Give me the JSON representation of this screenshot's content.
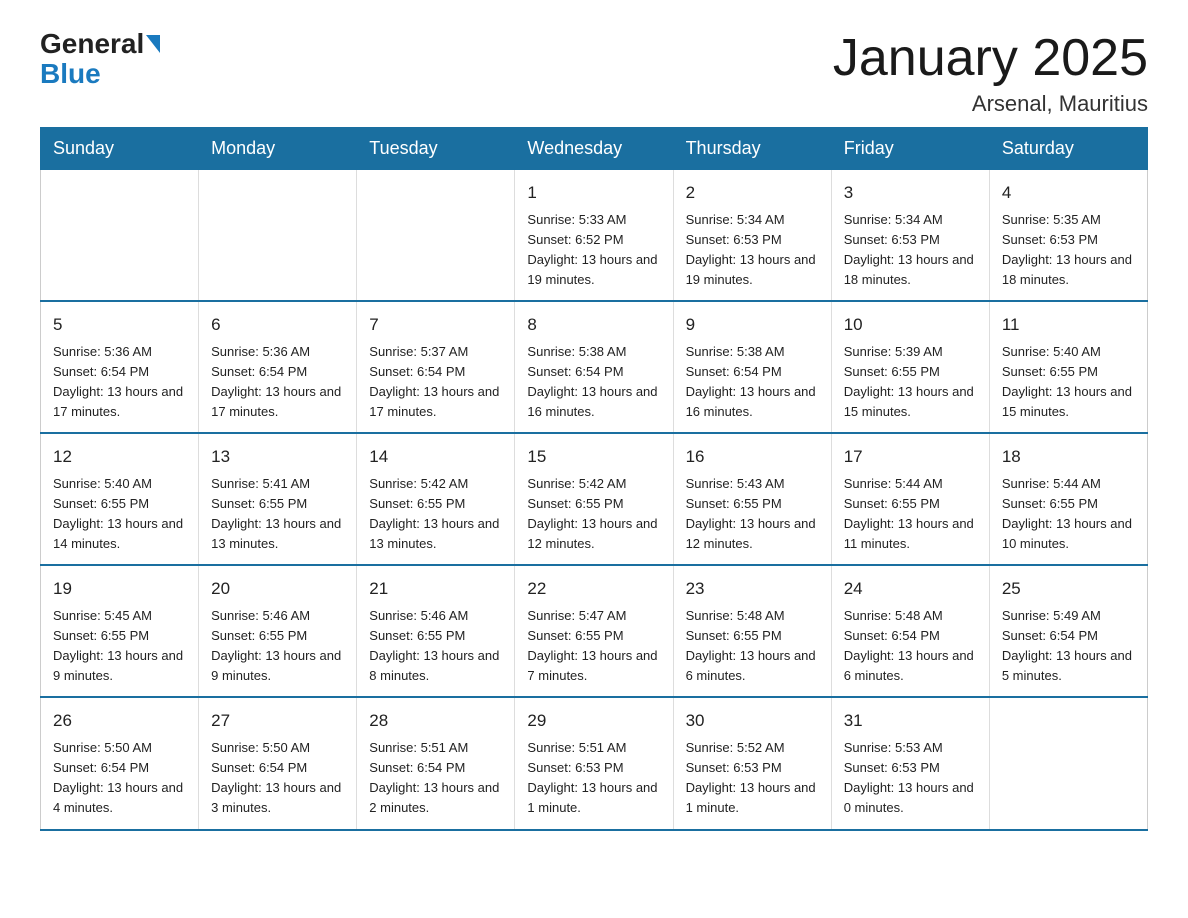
{
  "logo": {
    "general": "General",
    "blue": "Blue"
  },
  "title": "January 2025",
  "location": "Arsenal, Mauritius",
  "days_of_week": [
    "Sunday",
    "Monday",
    "Tuesday",
    "Wednesday",
    "Thursday",
    "Friday",
    "Saturday"
  ],
  "weeks": [
    [
      {
        "day": "",
        "info": ""
      },
      {
        "day": "",
        "info": ""
      },
      {
        "day": "",
        "info": ""
      },
      {
        "day": "1",
        "info": "Sunrise: 5:33 AM\nSunset: 6:52 PM\nDaylight: 13 hours and 19 minutes."
      },
      {
        "day": "2",
        "info": "Sunrise: 5:34 AM\nSunset: 6:53 PM\nDaylight: 13 hours and 19 minutes."
      },
      {
        "day": "3",
        "info": "Sunrise: 5:34 AM\nSunset: 6:53 PM\nDaylight: 13 hours and 18 minutes."
      },
      {
        "day": "4",
        "info": "Sunrise: 5:35 AM\nSunset: 6:53 PM\nDaylight: 13 hours and 18 minutes."
      }
    ],
    [
      {
        "day": "5",
        "info": "Sunrise: 5:36 AM\nSunset: 6:54 PM\nDaylight: 13 hours and 17 minutes."
      },
      {
        "day": "6",
        "info": "Sunrise: 5:36 AM\nSunset: 6:54 PM\nDaylight: 13 hours and 17 minutes."
      },
      {
        "day": "7",
        "info": "Sunrise: 5:37 AM\nSunset: 6:54 PM\nDaylight: 13 hours and 17 minutes."
      },
      {
        "day": "8",
        "info": "Sunrise: 5:38 AM\nSunset: 6:54 PM\nDaylight: 13 hours and 16 minutes."
      },
      {
        "day": "9",
        "info": "Sunrise: 5:38 AM\nSunset: 6:54 PM\nDaylight: 13 hours and 16 minutes."
      },
      {
        "day": "10",
        "info": "Sunrise: 5:39 AM\nSunset: 6:55 PM\nDaylight: 13 hours and 15 minutes."
      },
      {
        "day": "11",
        "info": "Sunrise: 5:40 AM\nSunset: 6:55 PM\nDaylight: 13 hours and 15 minutes."
      }
    ],
    [
      {
        "day": "12",
        "info": "Sunrise: 5:40 AM\nSunset: 6:55 PM\nDaylight: 13 hours and 14 minutes."
      },
      {
        "day": "13",
        "info": "Sunrise: 5:41 AM\nSunset: 6:55 PM\nDaylight: 13 hours and 13 minutes."
      },
      {
        "day": "14",
        "info": "Sunrise: 5:42 AM\nSunset: 6:55 PM\nDaylight: 13 hours and 13 minutes."
      },
      {
        "day": "15",
        "info": "Sunrise: 5:42 AM\nSunset: 6:55 PM\nDaylight: 13 hours and 12 minutes."
      },
      {
        "day": "16",
        "info": "Sunrise: 5:43 AM\nSunset: 6:55 PM\nDaylight: 13 hours and 12 minutes."
      },
      {
        "day": "17",
        "info": "Sunrise: 5:44 AM\nSunset: 6:55 PM\nDaylight: 13 hours and 11 minutes."
      },
      {
        "day": "18",
        "info": "Sunrise: 5:44 AM\nSunset: 6:55 PM\nDaylight: 13 hours and 10 minutes."
      }
    ],
    [
      {
        "day": "19",
        "info": "Sunrise: 5:45 AM\nSunset: 6:55 PM\nDaylight: 13 hours and 9 minutes."
      },
      {
        "day": "20",
        "info": "Sunrise: 5:46 AM\nSunset: 6:55 PM\nDaylight: 13 hours and 9 minutes."
      },
      {
        "day": "21",
        "info": "Sunrise: 5:46 AM\nSunset: 6:55 PM\nDaylight: 13 hours and 8 minutes."
      },
      {
        "day": "22",
        "info": "Sunrise: 5:47 AM\nSunset: 6:55 PM\nDaylight: 13 hours and 7 minutes."
      },
      {
        "day": "23",
        "info": "Sunrise: 5:48 AM\nSunset: 6:55 PM\nDaylight: 13 hours and 6 minutes."
      },
      {
        "day": "24",
        "info": "Sunrise: 5:48 AM\nSunset: 6:54 PM\nDaylight: 13 hours and 6 minutes."
      },
      {
        "day": "25",
        "info": "Sunrise: 5:49 AM\nSunset: 6:54 PM\nDaylight: 13 hours and 5 minutes."
      }
    ],
    [
      {
        "day": "26",
        "info": "Sunrise: 5:50 AM\nSunset: 6:54 PM\nDaylight: 13 hours and 4 minutes."
      },
      {
        "day": "27",
        "info": "Sunrise: 5:50 AM\nSunset: 6:54 PM\nDaylight: 13 hours and 3 minutes."
      },
      {
        "day": "28",
        "info": "Sunrise: 5:51 AM\nSunset: 6:54 PM\nDaylight: 13 hours and 2 minutes."
      },
      {
        "day": "29",
        "info": "Sunrise: 5:51 AM\nSunset: 6:53 PM\nDaylight: 13 hours and 1 minute."
      },
      {
        "day": "30",
        "info": "Sunrise: 5:52 AM\nSunset: 6:53 PM\nDaylight: 13 hours and 1 minute."
      },
      {
        "day": "31",
        "info": "Sunrise: 5:53 AM\nSunset: 6:53 PM\nDaylight: 13 hours and 0 minutes."
      },
      {
        "day": "",
        "info": ""
      }
    ]
  ]
}
